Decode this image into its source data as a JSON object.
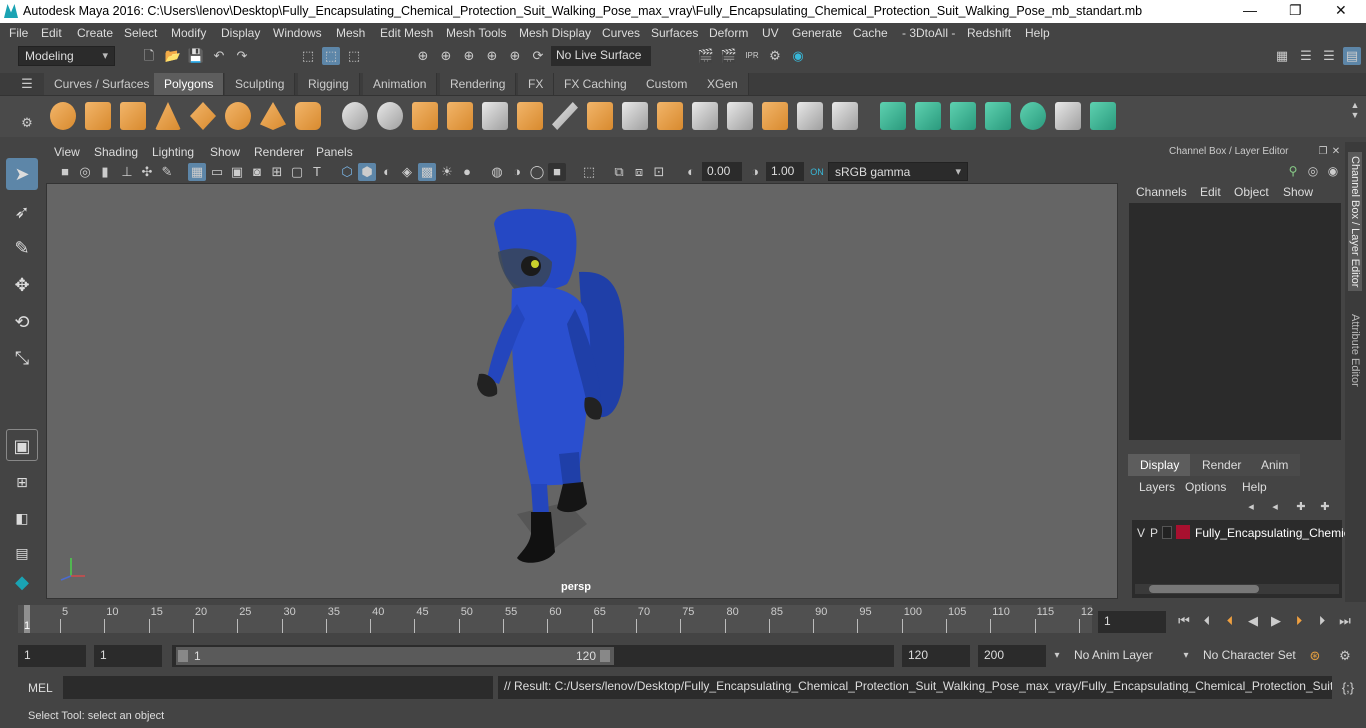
{
  "window": {
    "title": "Autodesk Maya 2016: C:\\Users\\lenov\\Desktop\\Fully_Encapsulating_Chemical_Protection_Suit_Walking_Pose_max_vray\\Fully_Encapsulating_Chemical_Protection_Suit_Walking_Pose_mb_standart.mb",
    "minimize": "—",
    "restore": "❐",
    "close": "✕"
  },
  "menu": [
    "File",
    "Edit",
    "Create",
    "Select",
    "Modify",
    "Display",
    "Windows",
    "Mesh",
    "Edit Mesh",
    "Mesh Tools",
    "Mesh Display",
    "Curves",
    "Surfaces",
    "Deform",
    "UV",
    "Generate",
    "Cache",
    "- 3DtoAll -",
    "Redshift",
    "Help"
  ],
  "status": {
    "mode": "Modeling",
    "live_surface": "No Live Surface"
  },
  "shelf_tabs": [
    "Curves / Surfaces",
    "Polygons",
    "Sculpting",
    "Rigging",
    "Animation",
    "Rendering",
    "FX",
    "FX Caching",
    "Custom",
    "XGen"
  ],
  "shelf_active": "Polygons",
  "viewport": {
    "menus": [
      "View",
      "Shading",
      "Lighting",
      "Show",
      "Renderer",
      "Panels"
    ],
    "exposure": "0.00",
    "gamma": "1.00",
    "colorspace": "sRGB gamma",
    "camera": "persp"
  },
  "channel_box": {
    "title": "Channel Box / Layer Editor",
    "menus": [
      "Channels",
      "Edit",
      "Object",
      "Show"
    ],
    "layer_tabs": [
      "Display",
      "Render",
      "Anim"
    ],
    "layer_menus": [
      "Layers",
      "Options",
      "Help"
    ],
    "layer": {
      "v": "V",
      "p": "P",
      "name": "Fully_Encapsulating_Chemica",
      "color": "#a8102f"
    }
  },
  "side_tabs": [
    "Channel Box / Layer Editor",
    "Attribute Editor"
  ],
  "timeline": {
    "ticks": [
      "5",
      "10",
      "15",
      "20",
      "25",
      "30",
      "35",
      "40",
      "45",
      "50",
      "55",
      "60",
      "65",
      "70",
      "75",
      "80",
      "85",
      "90",
      "95",
      "100",
      "105",
      "110",
      "115",
      "12"
    ],
    "start_marker": "1",
    "current_frame": "1"
  },
  "range": {
    "start": "1",
    "anim_start": "1",
    "slider_start": "1",
    "slider_end": "120",
    "end": "120",
    "anim_end": "200",
    "anim_layer": "No Anim Layer",
    "character_set": "No Character Set"
  },
  "command": {
    "mode": "MEL",
    "result": "// Result: C:/Users/lenov/Desktop/Fully_Encapsulating_Chemical_Protection_Suit_Walking_Pose_max_vray/Fully_Encapsulating_Chemical_Protection_Suit_Walking"
  },
  "help_line": "Select Tool: select an object"
}
